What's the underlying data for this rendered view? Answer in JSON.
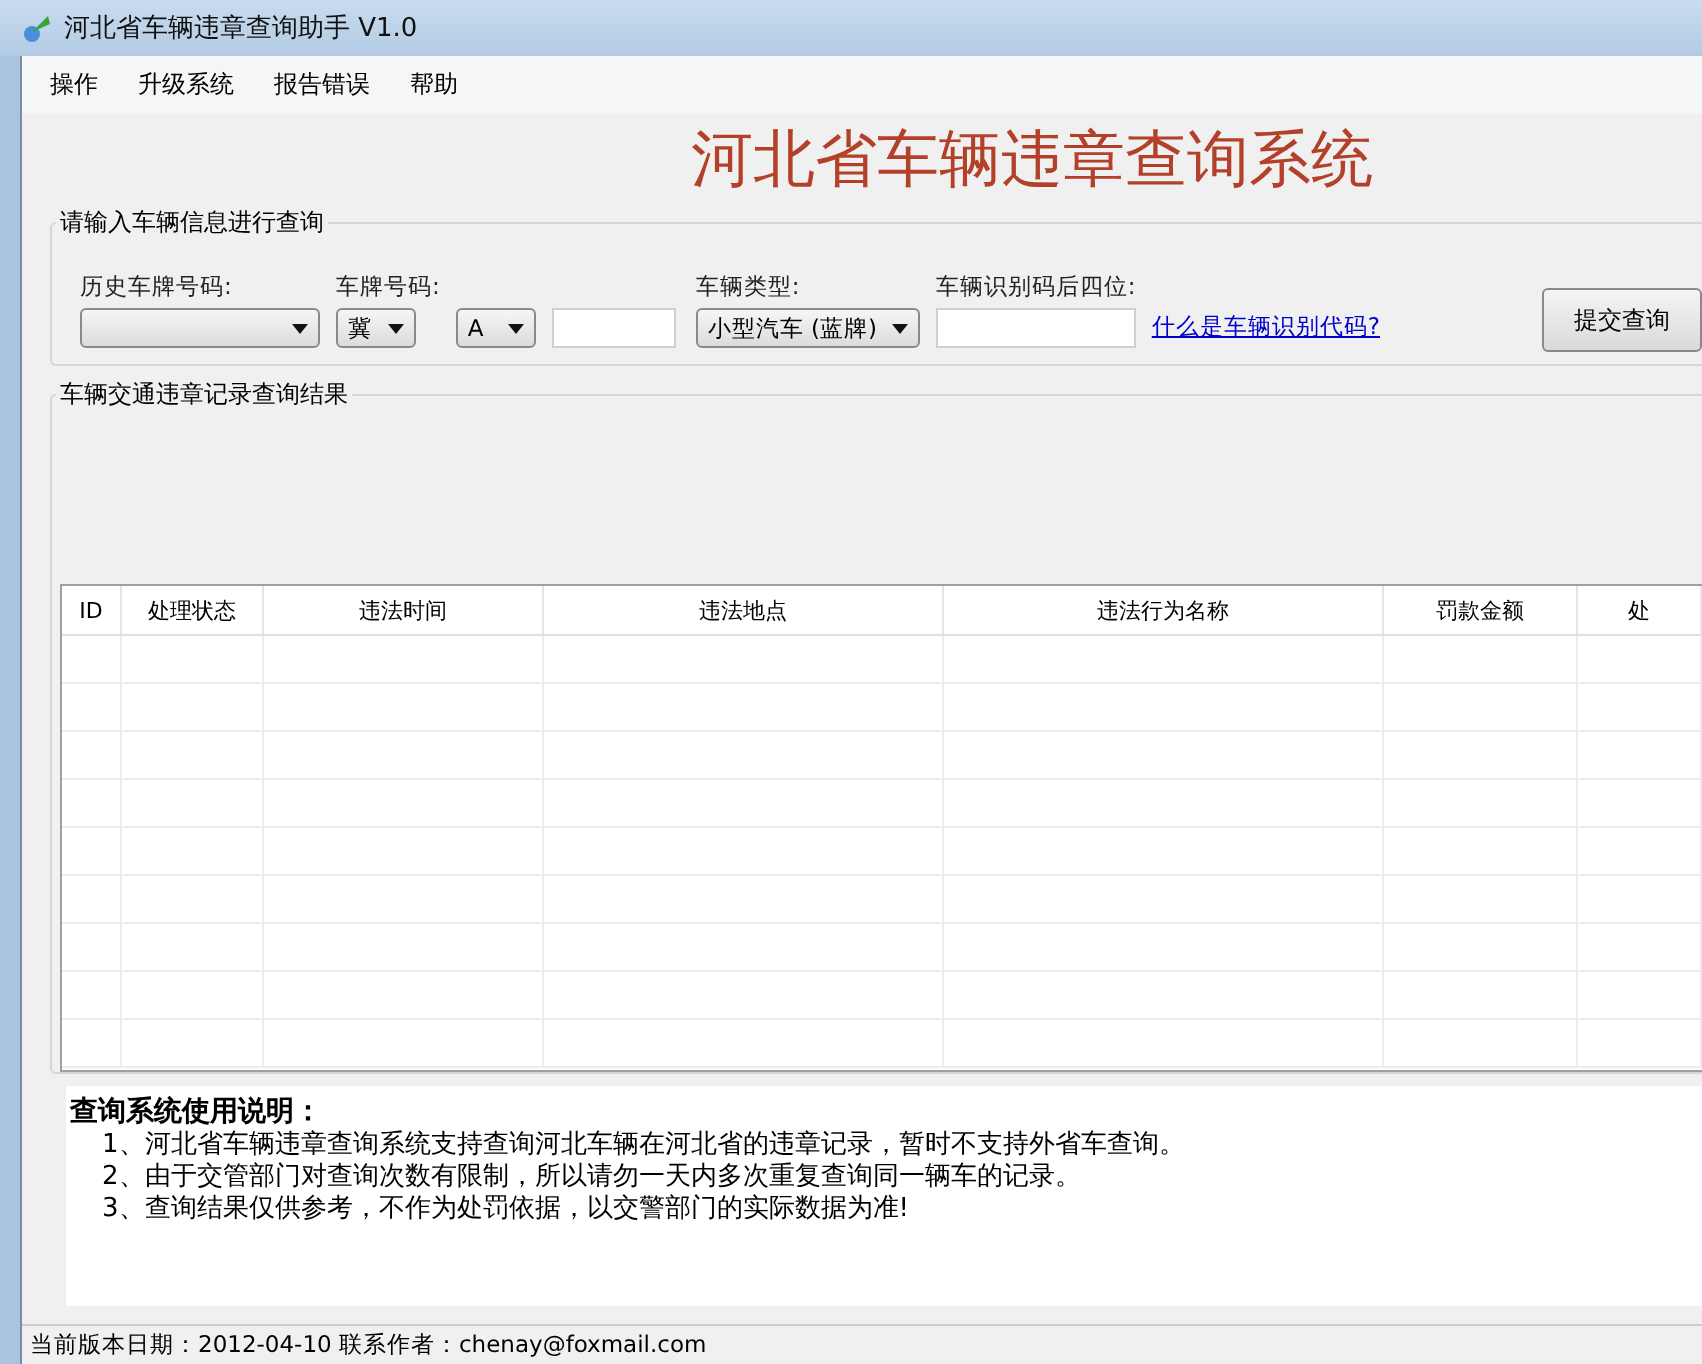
{
  "window": {
    "title": "河北省车辆违章查询助手 V1.0"
  },
  "menu": [
    "操作",
    "升级系统",
    "报告错误",
    "帮助"
  ],
  "heading": "河北省车辆违章查询系统",
  "query_group": {
    "title": "请输入车辆信息进行查询",
    "fields": [
      {
        "kind": "select",
        "label": "历史车牌号码:"
      },
      {
        "kind": "select",
        "label": "车牌号码:",
        "value": "冀"
      },
      {
        "kind": "select",
        "value": "A"
      },
      {
        "kind": "input"
      },
      {
        "kind": "select",
        "label": "车辆类型:",
        "value": "小型汽车 (蓝牌)"
      },
      {
        "kind": "input",
        "label": "车辆识别码后四位:"
      }
    ],
    "link": "什么是车辆识别代码?",
    "submit": "提交查询"
  },
  "results_group": {
    "title": "车辆交通违章记录查询结果",
    "columns": [
      "ID",
      "处理状态",
      "违法时间",
      "违法地点",
      "违法行为名称",
      "罚款金额",
      "处"
    ]
  },
  "instructions": {
    "title": "查询系统使用说明：",
    "lines": [
      "1、河北省车辆违章查询系统支持查询河北车辆在河北省的违章记录，暂时不支持外省车查询。",
      "2、由于交管部门对查询次数有限制，所以请勿一天内多次重复查询同一辆车的记录。",
      "3、查询结果仅供参考，不作为处罚依据，以交警部门的实际数据为准!"
    ]
  },
  "status_bar": "当前版本日期：2012-04-10  联系作者：chenay@foxmail.com"
}
